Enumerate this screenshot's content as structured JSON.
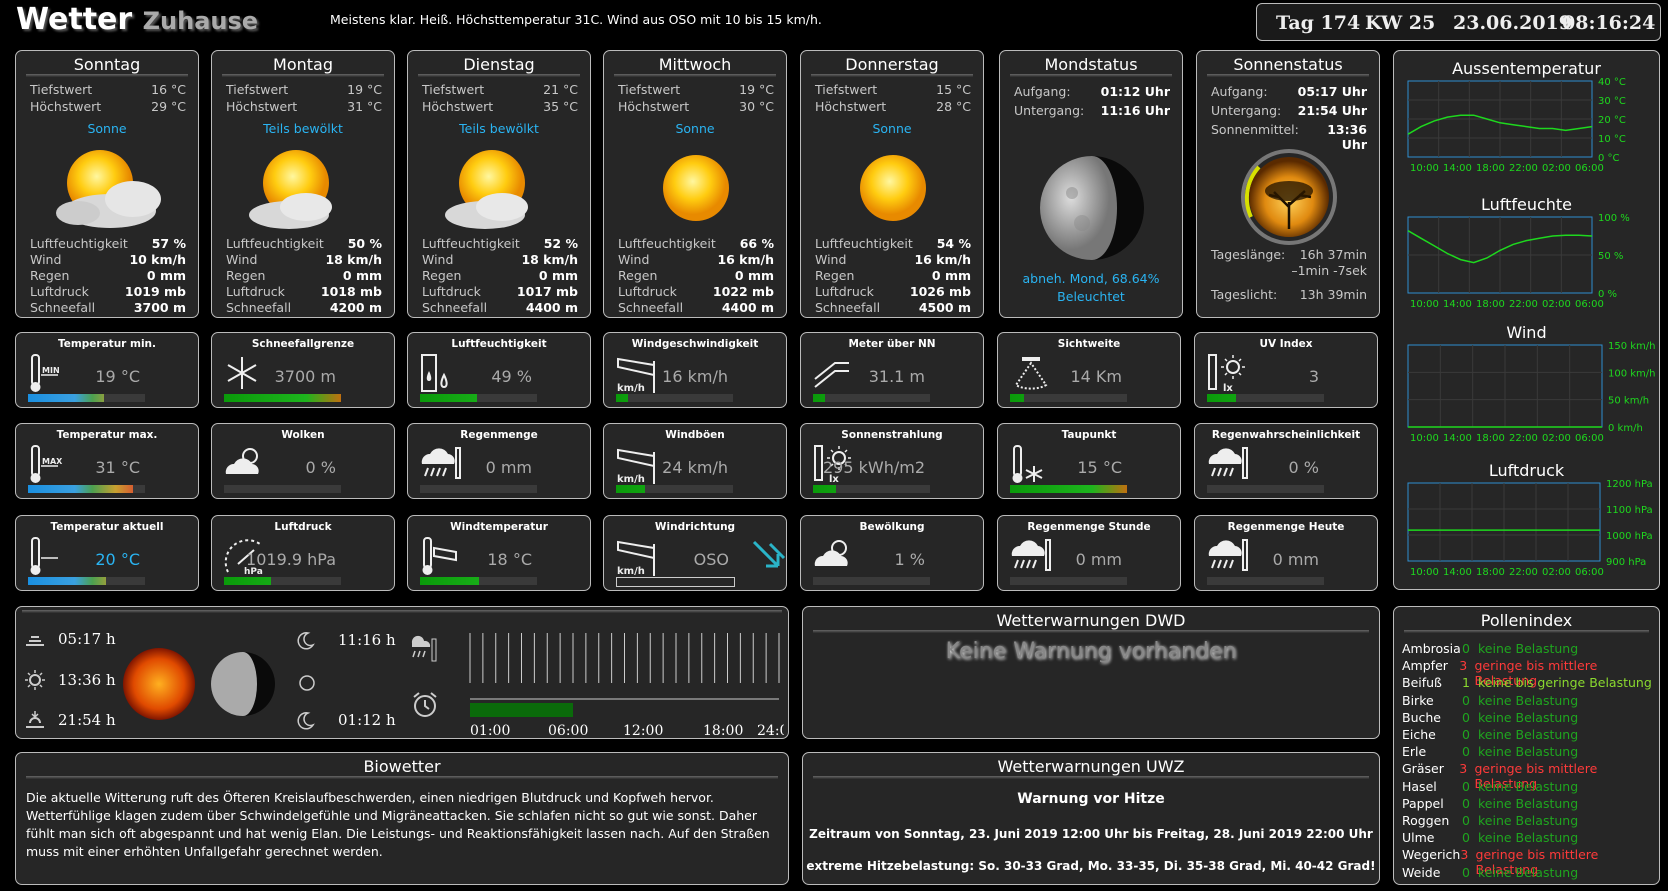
{
  "header": {
    "title_main": "Wetter",
    "title_sub": "Zuhause",
    "forecast_text": "Meistens klar. Heiß. Höchsttemperatur 31C. Wind aus OSO mit 10 bis 15 km/h.",
    "day": "Tag 174",
    "week": "KW 25",
    "date": "23.06.2019",
    "time": "08:16:24"
  },
  "days": [
    {
      "name": "Sonntag",
      "min": "16 °C",
      "max": "29 °C",
      "desc": "Sonne",
      "humidity": "57 %",
      "wind": "10 km/h",
      "rain": "0 mm",
      "pressure": "1019 mb",
      "snow": "3700 m",
      "icon": "sun-clouds-icon"
    },
    {
      "name": "Montag",
      "min": "19 °C",
      "max": "31 °C",
      "desc": "Teils bewölkt",
      "humidity": "50 %",
      "wind": "18 km/h",
      "rain": "0 mm",
      "pressure": "1018 mb",
      "snow": "4200 m",
      "icon": "partly-cloudy-icon"
    },
    {
      "name": "Dienstag",
      "min": "21 °C",
      "max": "35 °C",
      "desc": "Teils bewölkt",
      "humidity": "52 %",
      "wind": "18 km/h",
      "rain": "0 mm",
      "pressure": "1017 mb",
      "snow": "4400 m",
      "icon": "partly-cloudy-icon"
    },
    {
      "name": "Mittwoch",
      "min": "19 °C",
      "max": "30 °C",
      "desc": "Sonne",
      "humidity": "66 %",
      "wind": "16 km/h",
      "rain": "0 mm",
      "pressure": "1022 mb",
      "snow": "4400 m",
      "icon": "sun-icon"
    },
    {
      "name": "Donnerstag",
      "min": "15 °C",
      "max": "28 °C",
      "desc": "Sonne",
      "humidity": "54 %",
      "wind": "16 km/h",
      "rain": "0 mm",
      "pressure": "1026 mb",
      "snow": "4500 m",
      "icon": "sun-icon"
    }
  ],
  "day_labels": {
    "min": "Tiefstwert",
    "max": "Höchstwert",
    "humidity": "Luftfeuchtigkeit",
    "wind": "Wind",
    "rain": "Regen",
    "pressure": "Luftdruck",
    "snow": "Schneefall"
  },
  "moon": {
    "title": "Mondstatus",
    "rise_label": "Aufgang:",
    "rise": "01:12 Uhr",
    "set_label": "Untergang:",
    "set": "11:16 Uhr",
    "phase": "abneh. Mond, 68.64%",
    "lit": "Beleuchtet"
  },
  "sun": {
    "title": "Sonnenstatus",
    "rise_label": "Aufgang:",
    "rise": "05:17 Uhr",
    "set_label": "Untergang:",
    "set": "21:54 Uhr",
    "noon_label": "Sonnenmittel:",
    "noon": "13:36 Uhr",
    "length_label": "Tageslänge:",
    "length": "16h 37min",
    "length_diff": "–1min -7sek",
    "light_label": "Tageslicht:",
    "light": "13h 39min"
  },
  "tiles": [
    {
      "title": "Temperatur min.",
      "value": "19 °C",
      "icon": "thermometer-min-icon",
      "fill": 0.65,
      "grad": "temp"
    },
    {
      "title": "Schneefallgrenze",
      "value": "3700 m",
      "icon": "snowflake-icon",
      "fill": 1.0,
      "grad": "green"
    },
    {
      "title": "Luftfeuchtigkeit",
      "value": "49 %",
      "icon": "humidity-icon",
      "fill": 0.49,
      "grad": "green"
    },
    {
      "title": "Windgeschwindigkeit",
      "value": "16 km/h",
      "icon": "windsock-icon",
      "fill": 0.1,
      "grad": "green"
    },
    {
      "title": "Meter über NN",
      "value": "31.1 m",
      "icon": "altitude-icon",
      "fill": 0.1,
      "grad": "green"
    },
    {
      "title": "Sichtweite",
      "value": "14 Km",
      "icon": "visibility-icon",
      "fill": 0.12,
      "grad": "green"
    },
    {
      "title": "UV Index",
      "value": "3",
      "icon": "uv-icon",
      "fill": 0.25,
      "grad": "green"
    },
    {
      "title": "Temperatur max.",
      "value": "31 °C",
      "icon": "thermometer-max-icon",
      "fill": 0.9,
      "grad": "temp"
    },
    {
      "title": "Wolken",
      "value": "0 %",
      "icon": "cloud-icon",
      "fill": 0,
      "grad": "green"
    },
    {
      "title": "Regenmenge",
      "value": "0 mm",
      "icon": "rain-icon",
      "fill": 0,
      "grad": "green"
    },
    {
      "title": "Windböen",
      "value": "24 km/h",
      "icon": "windsock-icon",
      "fill": 0.25,
      "grad": "green"
    },
    {
      "title": "Sonnenstrahlung",
      "value": "295 kWh/m2",
      "icon": "solar-icon",
      "fill": 0.2,
      "grad": "green"
    },
    {
      "title": "Taupunkt",
      "value": "15 °C",
      "icon": "dewpoint-icon",
      "fill": 1.0,
      "grad": "green"
    },
    {
      "title": "Regenwahrscheinlichkeit",
      "value": "0 %",
      "icon": "rain-icon",
      "fill": 0,
      "grad": "green"
    },
    {
      "title": "Temperatur aktuell",
      "value": "20 °C",
      "icon": "thermometer-icon",
      "fill": 0.67,
      "grad": "temp",
      "highlight": true
    },
    {
      "title": "Luftdruck",
      "value": "1019.9 hPa",
      "icon": "barometer-icon",
      "fill": 0.4,
      "grad": "green"
    },
    {
      "title": "Windtemperatur",
      "value": "18 °C",
      "icon": "wind-temp-icon",
      "fill": 0.5,
      "grad": "green"
    },
    {
      "title": "Windrichtung",
      "value": "OSO",
      "icon": "windsock-icon",
      "fill": 0,
      "grad": "none",
      "arrow": true
    },
    {
      "title": "Bewölkung",
      "value": "1 %",
      "icon": "cloud-icon",
      "fill": 0,
      "grad": "green"
    },
    {
      "title": "Regenmenge Stunde",
      "value": "0 mm",
      "icon": "rain-icon",
      "fill": 0,
      "grad": "green"
    },
    {
      "title": "Regenmenge Heute",
      "value": "0 mm",
      "icon": "rain-icon",
      "fill": 0,
      "grad": "green"
    }
  ],
  "charts": [
    {
      "title": "Aussentemperatur",
      "yticks": [
        "40 °C",
        "30 °C",
        "20 °C",
        "10 °C",
        "0 °C"
      ],
      "xticks": [
        "10:00",
        "14:00",
        "18:00",
        "22:00",
        "02:00",
        "06:00"
      ],
      "ylim": [
        0,
        40
      ],
      "values": [
        12,
        16,
        19,
        21,
        22,
        22,
        20,
        18,
        17,
        16,
        15,
        15,
        14,
        15,
        16
      ]
    },
    {
      "title": "Luftfeuchte",
      "yticks": [
        "100 %",
        "50 %",
        "0 %"
      ],
      "xticks": [
        "10:00",
        "14:00",
        "18:00",
        "22:00",
        "02:00",
        "06:00"
      ],
      "ylim": [
        0,
        100
      ],
      "values": [
        82,
        72,
        62,
        52,
        44,
        40,
        46,
        56,
        64,
        69,
        72,
        75,
        76,
        76,
        75
      ]
    },
    {
      "title": "Wind",
      "yticks": [
        "150 km/h",
        "100 km/h",
        "50 km/h",
        "0 km/h"
      ],
      "xticks": [
        "10:00",
        "14:00",
        "18:00",
        "22:00",
        "02:00",
        "06:00"
      ],
      "ylim": [
        0,
        150
      ],
      "values": [
        0,
        0,
        0,
        0,
        0,
        0,
        0,
        0,
        0,
        0,
        0,
        0,
        0,
        0,
        0
      ]
    },
    {
      "title": "Luftdruck",
      "yticks": [
        "1200 hPa",
        "1100 hPa",
        "1000 hPa",
        "900 hPa"
      ],
      "xticks": [
        "10:00",
        "14:00",
        "18:00",
        "22:00",
        "02:00",
        "06:00"
      ],
      "ylim": [
        900,
        1200
      ],
      "values": [
        1019,
        1019,
        1019,
        1019,
        1019,
        1019,
        1019,
        1019,
        1019,
        1019,
        1019,
        1019,
        1019,
        1019,
        1019
      ]
    }
  ],
  "timeline": {
    "sunrise": "05:17 h",
    "noon": "13:36 h",
    "sunset": "21:54 h",
    "moonset": "11:16 h",
    "moonrise": "01:12 h",
    "ticks": [
      "01:00",
      "06:00",
      "12:00",
      "18:00",
      "24:00"
    ]
  },
  "dwd": {
    "title": "Wetterwarnungen DWD",
    "text": "Keine Warnung vorhanden"
  },
  "bio": {
    "title": "Biowetter",
    "text": "Die aktuelle Witterung ruft des Öfteren Kreislaufbeschwerden, einen niedrigen Blutdruck und Kopfweh hervor. Wetterfühlige klagen zudem über Schwindelgefühle und Migräneattacken. Sie schlafen nicht so gut wie sonst. Daher fühlt man sich oft abgespannt und hat wenig Elan. Die Leistungs- und Reaktionsfähigkeit lassen nach. Auf den Straßen muss mit einer erhöhten Unfallgefahr gerechnet werden."
  },
  "uwz": {
    "title": "Wetterwarnungen UWZ",
    "headline": "Warnung vor Hitze",
    "period": "Zeitraum von Sonntag, 23. Juni 2019 12:00 Uhr bis Freitag, 28. Juni 2019 22:00 Uhr",
    "detail": "extreme Hitzebelastung: So. 30-33 Grad, Mo. 33-35, Di. 35-38 Grad, Mi. 40-42 Grad!"
  },
  "pollen": {
    "title": "Pollenindex",
    "items": [
      {
        "name": "Ambrosia",
        "level": "0",
        "text": "keine Belastung",
        "cls": "green"
      },
      {
        "name": "Ampfer",
        "level": "3",
        "text": "geringe bis mittlere Belastung",
        "cls": "red"
      },
      {
        "name": "Beifuß",
        "level": "1",
        "text": "keine bis geringe Belastung",
        "cls": "yg"
      },
      {
        "name": "Birke",
        "level": "0",
        "text": "keine Belastung",
        "cls": "green"
      },
      {
        "name": "Buche",
        "level": "0",
        "text": "keine Belastung",
        "cls": "green"
      },
      {
        "name": "Eiche",
        "level": "0",
        "text": "keine Belastung",
        "cls": "green"
      },
      {
        "name": "Erle",
        "level": "0",
        "text": "keine Belastung",
        "cls": "green"
      },
      {
        "name": "Gräser",
        "level": "3",
        "text": "geringe bis mittlere Belastung",
        "cls": "red"
      },
      {
        "name": "Hasel",
        "level": "0",
        "text": "keine Belastung",
        "cls": "green"
      },
      {
        "name": "Pappel",
        "level": "0",
        "text": "keine Belastung",
        "cls": "green"
      },
      {
        "name": "Roggen",
        "level": "0",
        "text": "keine Belastung",
        "cls": "green"
      },
      {
        "name": "Ulme",
        "level": "0",
        "text": "keine Belastung",
        "cls": "green"
      },
      {
        "name": "Wegerich",
        "level": "3",
        "text": "geringe bis mittlere Belastung",
        "cls": "red"
      },
      {
        "name": "Weide",
        "level": "0",
        "text": "keine Belastung",
        "cls": "green"
      }
    ]
  }
}
